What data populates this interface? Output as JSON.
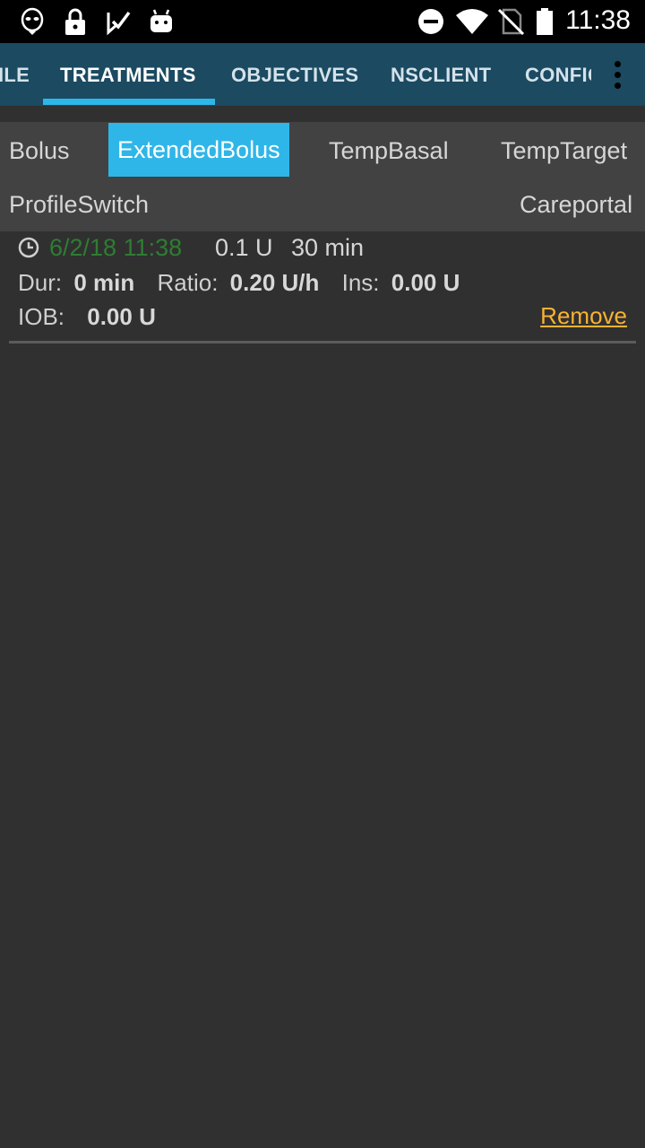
{
  "status_bar": {
    "time": "11:38",
    "left_icons": [
      "alien-icon",
      "lock-icon",
      "check-play-icon",
      "android-icon"
    ],
    "right_icons": [
      "dnd-icon",
      "wifi-icon",
      "no-sim-icon",
      "battery-icon"
    ]
  },
  "tabs": [
    {
      "label": "ILE",
      "active": false
    },
    {
      "label": "TREATMENTS",
      "active": true
    },
    {
      "label": "OBJECTIVES",
      "active": false
    },
    {
      "label": "NSCLIENT",
      "active": false
    },
    {
      "label": "CONFIG",
      "active": false
    }
  ],
  "subtabs": {
    "bolus": "Bolus",
    "extended_bolus": "ExtendedBolus",
    "temp_basal": "TempBasal",
    "temp_target": "TempTarget",
    "profile_switch": "ProfileSwitch",
    "careportal": "Careportal"
  },
  "entry": {
    "date": "6/2/18 11:38",
    "amount": "0.1 U",
    "duration": "30 min",
    "dur_label": "Dur:",
    "dur_value": "0 min",
    "ratio_label": "Ratio:",
    "ratio_value": "0.20 U/h",
    "ins_label": "Ins:",
    "ins_value": "0.00 U",
    "iob_label": "IOB:",
    "iob_value": "0.00 U",
    "remove_label": "Remove"
  },
  "colors": {
    "tabbar": "#1b4a61",
    "accent": "#2fb6e8",
    "date_green": "#2e7d32",
    "remove_orange": "#f9b233"
  }
}
